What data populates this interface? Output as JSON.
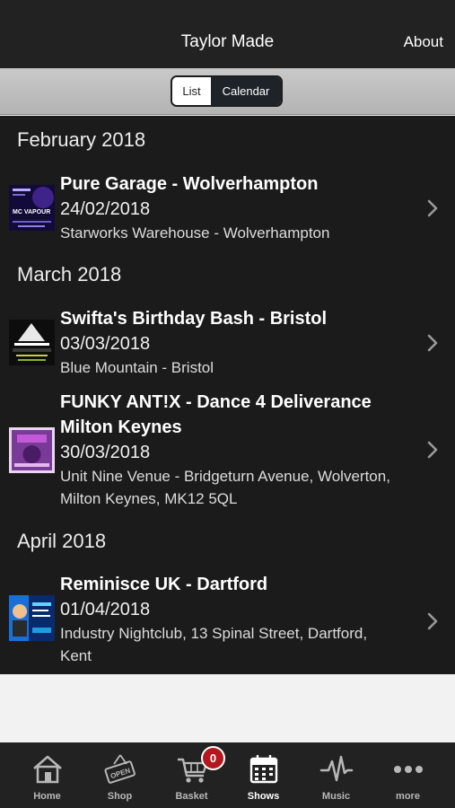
{
  "header": {
    "title": "Taylor Made",
    "about_label": "About"
  },
  "segment": {
    "list_label": "List",
    "calendar_label": "Calendar"
  },
  "months": [
    "February 2018",
    "March 2018",
    "April 2018"
  ],
  "events": [
    {
      "title": "Pure Garage - Wolverhampton",
      "date": "24/02/2018",
      "venue": "Starworks Warehouse - Wolverhampton",
      "thumb_text": "MC VAPOUR"
    },
    {
      "title": "Swifta's Birthday Bash - Bristol",
      "date": "03/03/2018",
      "venue": "Blue Mountain - Bristol"
    },
    {
      "title_line1": "FUNKY ANT!X - Dance 4 Deliverance",
      "title_line2": "Milton Keynes",
      "date": "30/03/2018",
      "venue_line1": "Unit Nine Venue - Bridgeturn Avenue, Wolverton,",
      "venue_line2": "Milton Keynes, MK12 5QL"
    },
    {
      "title": "Reminisce UK - Dartford",
      "date": "01/04/2018",
      "venue_line1": "Industry Nightclub, 13 Spinal Street, Dartford,",
      "venue_line2": "Kent"
    }
  ],
  "tabbar": {
    "items": [
      {
        "label": "Home",
        "icon": "home-icon"
      },
      {
        "label": "Shop",
        "icon": "open-sign-icon"
      },
      {
        "label": "Basket",
        "icon": "basket-icon"
      },
      {
        "label": "Shows",
        "icon": "calendar-icon"
      },
      {
        "label": "Music",
        "icon": "waveform-icon"
      },
      {
        "label": "more",
        "icon": "more-dots-icon"
      }
    ],
    "active": "Shows",
    "basket_count": "0"
  },
  "colors": {
    "accent_badge": "#b5171e",
    "header_bg": "#232223",
    "list_bg": "#1b1b1c"
  }
}
